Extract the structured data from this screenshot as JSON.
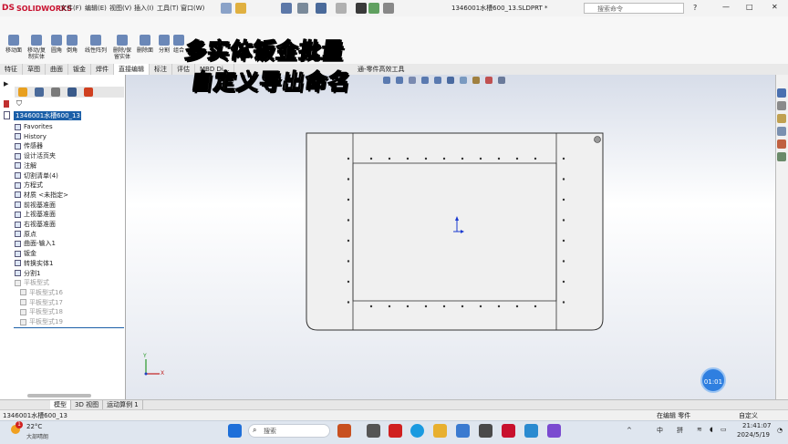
{
  "app": {
    "logo_text": "SOLIDWORKS",
    "logo_prefix": "DS",
    "doc_title": "1346001水槽600_13.SLDPRT *",
    "search_placeholder": "搜索命令",
    "menus": [
      "文件(F)",
      "编辑(E)",
      "视图(V)",
      "插入(I)",
      "工具(T)",
      "窗口(W)"
    ]
  },
  "ribbon": {
    "buttons": [
      "移动面",
      "移动/复制实体",
      "圆角",
      "倒角",
      "线性阵列",
      "删除/保留实体",
      "删除面",
      "分割",
      "组合"
    ]
  },
  "tabs": [
    "特征",
    "草图",
    "曲面",
    "钣金",
    "焊件",
    "直接编辑",
    "标注",
    "评估",
    "MBD Di..."
  ],
  "tabs_extra": "通-零件高效工具",
  "tree": {
    "part_name": "1346001水槽600_13",
    "items": [
      {
        "label": "Favorites",
        "grey": false
      },
      {
        "label": "History",
        "grey": false
      },
      {
        "label": "传感器",
        "grey": false
      },
      {
        "label": "设计活页夹",
        "grey": false
      },
      {
        "label": "注解",
        "grey": false
      },
      {
        "label": "切割清单(4)",
        "grey": false
      },
      {
        "label": "方程式",
        "grey": false
      },
      {
        "label": "材质 <未指定>",
        "grey": false
      },
      {
        "label": "前视基准面",
        "grey": false
      },
      {
        "label": "上视基准面",
        "grey": false
      },
      {
        "label": "右视基准面",
        "grey": false
      },
      {
        "label": "原点",
        "grey": false
      },
      {
        "label": "曲面-输入1",
        "grey": false
      },
      {
        "label": "钣金",
        "grey": false
      },
      {
        "label": "转换实体1",
        "grey": false
      },
      {
        "label": "分割1",
        "grey": false
      },
      {
        "label": "平板型式",
        "grey": true
      },
      {
        "label": "平板型式16",
        "grey": true
      },
      {
        "label": "平板型式17",
        "grey": true
      },
      {
        "label": "平板型式18",
        "grey": true
      },
      {
        "label": "平板型式19",
        "grey": true
      }
    ]
  },
  "model_tabs": [
    "模型",
    "3D 视图",
    "运动算例 1"
  ],
  "status": {
    "left": "1346001水槽600_13",
    "mode": "在编辑 零件",
    "custom": "自定义"
  },
  "overlay": {
    "line1": "多实体钣金批量",
    "line2": "自定义导出命名"
  },
  "timer": "01:01",
  "triad": {
    "y": "Y",
    "x": "X"
  },
  "taskbar": {
    "weather_temp": "22°C",
    "weather_desc": "大部晴朗",
    "weather_badge": "1",
    "search_text": "搜索",
    "ime_mid": "中",
    "ime": "拼",
    "time": "21:41:07",
    "date": "2024/5/19"
  }
}
